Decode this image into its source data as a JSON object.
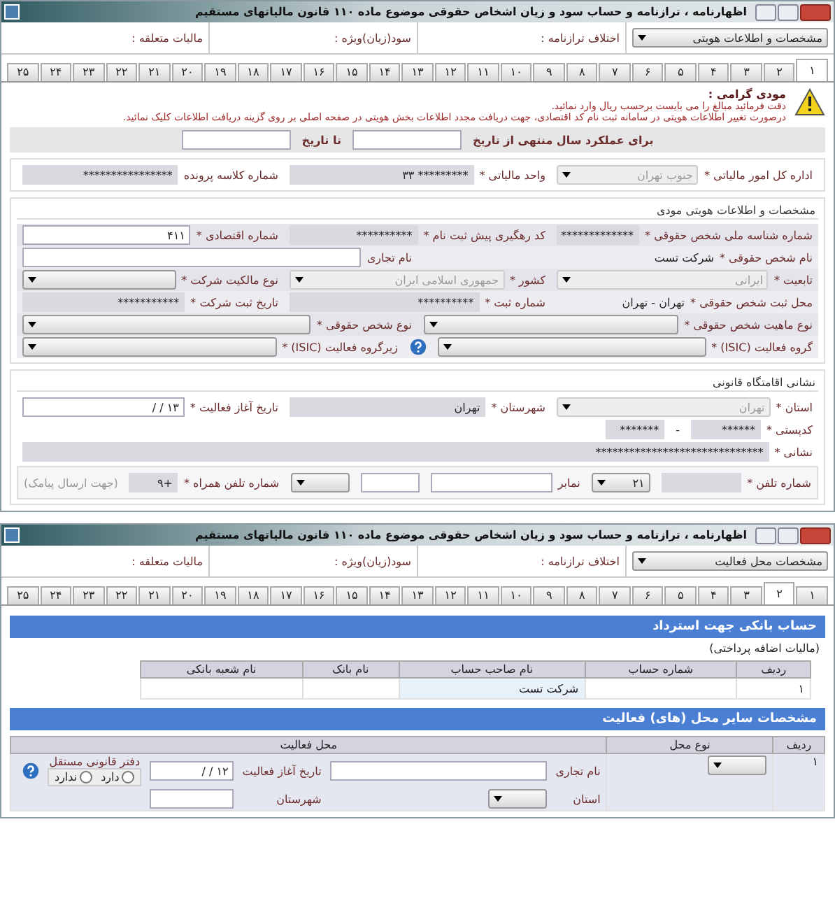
{
  "windows": [
    {
      "kind": "identity",
      "title": "اظهارنامه ، ترازنامه و حساب سود و زیان اشخاص حقوقی موضوع ماده ۱۱۰ قانون مالیاتهای مستقیم",
      "section_select": "مشخصات و اطلاعات هویتی",
      "summary": [
        "اختلاف ترازنامه :",
        "سود(زیان)ویژه :",
        "مالیات متعلقه :"
      ],
      "tabs": [
        {
          "label": "۱",
          "selected": true
        },
        {
          "label": "۲",
          "selected": false
        },
        {
          "label": "۳",
          "selected": false
        },
        {
          "label": "۴",
          "selected": false
        },
        {
          "label": "۵",
          "selected": false
        },
        {
          "label": "۶",
          "selected": false
        },
        {
          "label": "۷",
          "selected": false
        },
        {
          "label": "۸",
          "selected": false
        },
        {
          "label": "۹",
          "selected": false
        },
        {
          "label": "۱۰",
          "selected": false
        },
        {
          "label": "۱۱",
          "selected": false
        },
        {
          "label": "۱۲",
          "selected": false
        },
        {
          "label": "۱۳",
          "selected": false
        },
        {
          "label": "۱۴",
          "selected": false
        },
        {
          "label": "۱۵",
          "selected": false
        },
        {
          "label": "۱۶",
          "selected": false
        },
        {
          "label": "۱۷",
          "selected": false
        },
        {
          "label": "۱۸",
          "selected": false
        },
        {
          "label": "۱۹",
          "selected": false
        },
        {
          "label": "۲۰",
          "selected": false
        },
        {
          "label": "۲۱",
          "selected": false
        },
        {
          "label": "۲۲",
          "selected": false
        },
        {
          "label": "۲۳",
          "selected": false
        },
        {
          "label": "۲۴",
          "selected": false
        },
        {
          "label": "۲۵",
          "selected": false
        }
      ],
      "notice": {
        "heading": "مودی گرامی :",
        "lines": [
          "دقت فرمائید مبالغ را می بایست برحسب ریال وارد نمائید.",
          "درصورت تغییر اطلاعات هویتی در سامانه ثبت نام کد اقتصادی، جهت دریافت مجدد اطلاعات بخش هویتی در صفحه اصلی بر روی گزینه دریافت اطلاعات کلیک نمائید."
        ]
      },
      "period": {
        "from_label": "برای عملکرد سال منتهی از تاریخ",
        "to_label": "تا تاریخ"
      },
      "tax_office_row": [
        {
          "label": "اداره کل امور مالیاتی *",
          "kind": "select",
          "value": "جنوب تهران",
          "disabled": true
        },
        {
          "label": "واحد مالیاتی *",
          "kind": "readonly",
          "value": "********* ۳۳"
        },
        {
          "label": "شماره کلاسه پرونده",
          "kind": "readonly",
          "value": "****************"
        }
      ],
      "identity_section": {
        "title": "مشخصات و اطلاعات هویتی مودی",
        "rows": [
          {
            "kind": "grid",
            "fields": [
              {
                "label": "شماره شناسه ملی شخص حقوقی *",
                "kind": "readonly",
                "value": "*************"
              },
              {
                "label": "کد رهگیری پیش ثبت نام *",
                "kind": "readonly",
                "value": "**********"
              },
              {
                "label": "شماره اقتصادی *",
                "kind": "text",
                "value": "۴۱۱"
              }
            ]
          },
          {
            "kind": "grid",
            "fields": [
              {
                "label": "نام شخص حقوقی *",
                "kind": "plain",
                "value": "شرکت تست"
              },
              {
                "label": "نام تجاری",
                "kind": "text"
              }
            ]
          },
          {
            "kind": "grid",
            "fields": [
              {
                "label": "تابعیت *",
                "kind": "select",
                "value": "ایرانی",
                "disabled": true
              },
              {
                "label": "کشور *",
                "kind": "select",
                "value": "جمهوری اسلامی ایران",
                "disabled": true
              },
              {
                "label": "نوع مالکیت شرکت *",
                "kind": "select",
                "disabled": false
              }
            ]
          },
          {
            "kind": "grid",
            "fields": [
              {
                "label": "محل ثبت شخص حقوقی *",
                "kind": "plain",
                "value": "تهران - تهران"
              },
              {
                "label": "شماره ثبت *",
                "kind": "readonly",
                "value": "**********"
              },
              {
                "label": "تاریخ ثبت شرکت *",
                "kind": "readonly",
                "value": "***********"
              }
            ]
          },
          {
            "kind": "grid",
            "fields": [
              {
                "label": "نوع ماهیت شخص حقوقی *",
                "kind": "select",
                "disabled": false
              },
              {
                "label": "نوع شخص حقوقی *",
                "kind": "select",
                "disabled": false
              }
            ]
          },
          {
            "kind": "grid",
            "fields": [
              {
                "label": "گروه فعالیت (ISIC) *",
                "kind": "select",
                "disabled": false
              },
              {
                "kind": "help"
              },
              {
                "label": "زیرگروه فعالیت (ISIC) *",
                "kind": "select",
                "disabled": false
              }
            ]
          }
        ]
      },
      "address_section": {
        "title": "نشانی اقامتگاه قانونی",
        "rows": [
          {
            "kind": "grid",
            "fields": [
              {
                "label": "استان *",
                "kind": "select",
                "value": "تهران",
                "disabled": true
              },
              {
                "label": "شهرستان *",
                "kind": "readonly",
                "value": "تهران"
              },
              {
                "label": "تاریخ آغاز فعالیت *",
                "kind": "text",
                "value": "۱۳ / /"
              }
            ]
          },
          {
            "kind": "inline",
            "fields": [
              {
                "label": "کدپستی *",
                "kind": "readonly",
                "value": "******"
              },
              {
                "kind": "plain",
                "value": "-"
              },
              {
                "kind": "readonly",
                "value": "*******"
              }
            ]
          },
          {
            "kind": "grid",
            "fields": [
              {
                "label": "نشانی *",
                "kind": "readonly",
                "value": "******************************"
              }
            ]
          },
          {
            "kind": "boxed",
            "fields": [
              {
                "label": "شماره تلفن *",
                "kind": "readonly"
              },
              {
                "kind": "select",
                "value": "۲۱",
                "disabled": false
              },
              {
                "label": "نمابر",
                "kind": "text"
              },
              {
                "kind": "text"
              },
              {
                "kind": "select",
                "disabled": false
              },
              {
                "label": "شماره تلفن همراه *",
                "kind": "readonly",
                "value": "+۹"
              },
              {
                "kind": "note",
                "value": "(جهت ارسال پیامک)"
              }
            ]
          }
        ]
      }
    },
    {
      "kind": "activity",
      "title": "اظهارنامه ، ترازنامه و حساب سود و زیان اشخاص حقوقی موضوع ماده ۱۱۰ قانون مالیاتهای مستقیم",
      "section_select": "مشخصات محل فعالیت",
      "summary": [
        "اختلاف ترازنامه :",
        "سود(زیان)ویژه :",
        "مالیات متعلقه :"
      ],
      "tabs": [
        {
          "label": "۱",
          "selected": false
        },
        {
          "label": "۲",
          "selected": true
        },
        {
          "label": "۳",
          "selected": false
        },
        {
          "label": "۴",
          "selected": false
        },
        {
          "label": "۵",
          "selected": false
        },
        {
          "label": "۶",
          "selected": false
        },
        {
          "label": "۷",
          "selected": false
        },
        {
          "label": "۸",
          "selected": false
        },
        {
          "label": "۹",
          "selected": false
        },
        {
          "label": "۱۰",
          "selected": false
        },
        {
          "label": "۱۱",
          "selected": false
        },
        {
          "label": "۱۲",
          "selected": false
        },
        {
          "label": "۱۳",
          "selected": false
        },
        {
          "label": "۱۴",
          "selected": false
        },
        {
          "label": "۱۵",
          "selected": false
        },
        {
          "label": "۱۶",
          "selected": false
        },
        {
          "label": "۱۷",
          "selected": false
        },
        {
          "label": "۱۸",
          "selected": false
        },
        {
          "label": "۱۹",
          "selected": false
        },
        {
          "label": "۲۰",
          "selected": false
        },
        {
          "label": "۲۱",
          "selected": false
        },
        {
          "label": "۲۲",
          "selected": false
        },
        {
          "label": "۲۳",
          "selected": false
        },
        {
          "label": "۲۴",
          "selected": false
        },
        {
          "label": "۲۵",
          "selected": false
        }
      ],
      "bank": {
        "title": "حساب بانکی جهت استرداد",
        "subtitle": "(مالیات اضافه پرداختی)",
        "columns": [
          "ردیف",
          "شماره حساب",
          "نام صاحب حساب",
          "نام بانک",
          "نام شعبه بانکی"
        ],
        "rows": [
          [
            "۱",
            null,
            "شرکت تست",
            null,
            null
          ]
        ]
      },
      "sites": {
        "title": "مشخصات سایر محل (های) فعالیت",
        "columns": [
          "ردیف",
          "نوع محل",
          "محل فعالیت"
        ],
        "rows": [
          {
            "row_number": "۱",
            "trade_name_label": "نام تجاری",
            "start_date_label": "تاریخ آغاز فعالیت",
            "start_date": "۱۲ / /",
            "office_label": "دفتر قانونی مستقل",
            "radios": [
              {
                "label": "دارد",
                "selected": false
              },
              {
                "label": "ندارد",
                "selected": false
              }
            ],
            "province_label": "استان",
            "city_label": "شهرستان"
          }
        ]
      }
    }
  ]
}
